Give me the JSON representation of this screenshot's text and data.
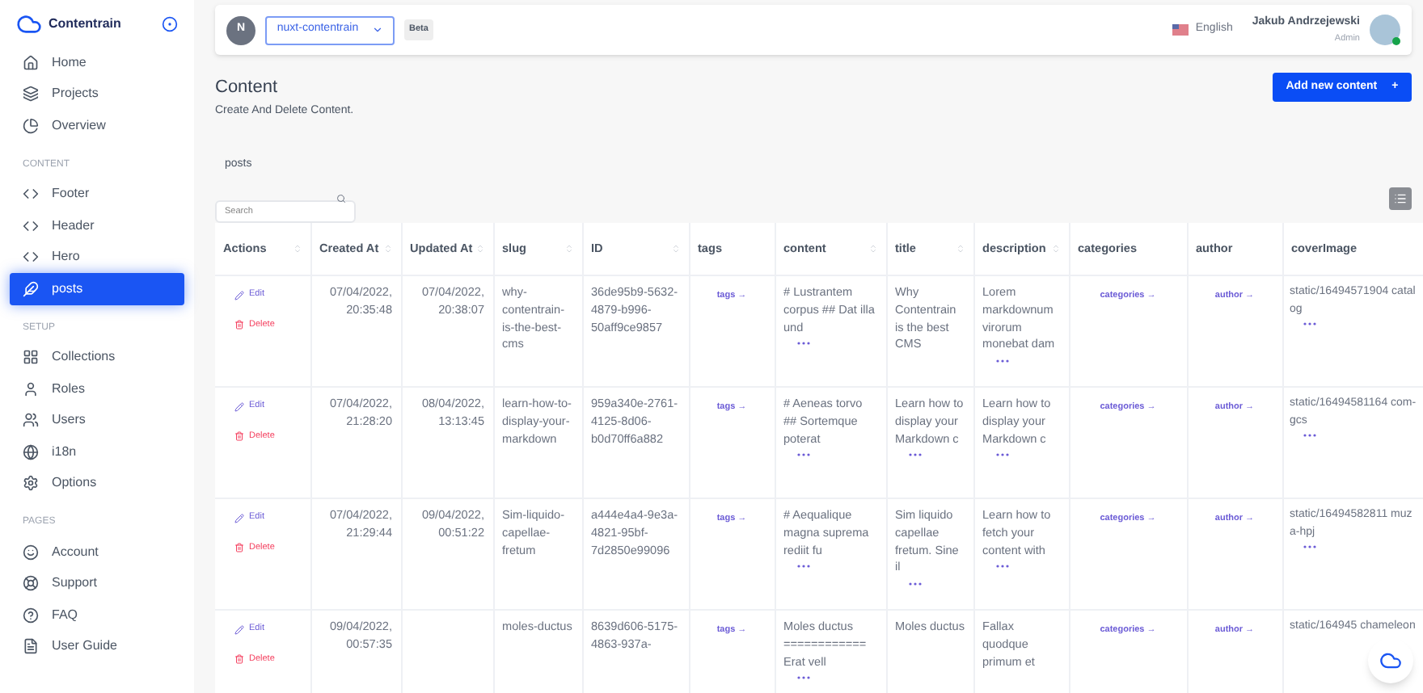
{
  "brand": "Contentrain",
  "sidebar": {
    "sections": [
      {
        "items": [
          {
            "label": "Home",
            "selected": false
          },
          {
            "label": "Projects",
            "selected": false
          },
          {
            "label": "Overview",
            "selected": false
          }
        ]
      },
      {
        "heading": "CONTENT",
        "items": [
          {
            "label": "Footer",
            "selected": false
          },
          {
            "label": "Header",
            "selected": false
          },
          {
            "label": "Hero",
            "selected": false
          },
          {
            "label": "posts",
            "selected": true
          }
        ]
      },
      {
        "heading": "SETUP",
        "items": [
          {
            "label": "Collections",
            "selected": false
          },
          {
            "label": "Roles",
            "selected": false
          },
          {
            "label": "Users",
            "selected": false
          },
          {
            "label": "i18n",
            "selected": false
          },
          {
            "label": "Options",
            "selected": false
          }
        ]
      },
      {
        "heading": "PAGES",
        "items": [
          {
            "label": "Account",
            "selected": false
          },
          {
            "label": "Support",
            "selected": false
          },
          {
            "label": "FAQ",
            "selected": false
          },
          {
            "label": "User Guide",
            "selected": false
          }
        ]
      }
    ]
  },
  "topbar": {
    "project_initial": "N",
    "project": "nuxt-contentrain",
    "badge": "Beta",
    "language": "English",
    "user_name": "Jakub Andrzejewski",
    "user_role": "Admin",
    "online": true
  },
  "page": {
    "title": "Content",
    "subtitle": "Create And Delete Content.",
    "add_button": "Add new content",
    "plus": "+"
  },
  "collection": "posts",
  "search": {
    "placeholder": "Search"
  },
  "table": {
    "columns": [
      {
        "label": "Actions",
        "sortable": true
      },
      {
        "label": "Created At",
        "sortable": true
      },
      {
        "label": "Updated At",
        "sortable": true
      },
      {
        "label": "slug",
        "sortable": true
      },
      {
        "label": "ID",
        "sortable": true
      },
      {
        "label": "tags",
        "sortable": false
      },
      {
        "label": "content",
        "sortable": true
      },
      {
        "label": "title",
        "sortable": true
      },
      {
        "label": "description",
        "sortable": true
      },
      {
        "label": "categories",
        "sortable": false
      },
      {
        "label": "author",
        "sortable": false
      },
      {
        "label": "coverImage",
        "sortable": false
      }
    ],
    "rows": [
      {
        "edit": "Edit",
        "delete": "Delete",
        "created": "07/04/2022, 20:35:48",
        "updated": "07/04/2022, 20:38:07",
        "slug": "why-contentrain-is-the-best-cms",
        "id": "36de95b9-5632-4879-b996-50aff9ce9857",
        "tags": "tags →",
        "content": {
          "text": "# Lustrantem corpus ## Dat illa und",
          "truncated": true
        },
        "title": {
          "text": "Why Contentrain is the best CMS",
          "truncated": false
        },
        "description": {
          "text": "Lorem markdownum virorum monebat dam",
          "truncated": true
        },
        "categories": "categories →",
        "author": "author →",
        "cover": {
          "text": "static/16494571904 catalog",
          "truncated": true
        }
      },
      {
        "edit": "Edit",
        "delete": "Delete",
        "created": "07/04/2022, 21:28:20",
        "updated": "08/04/2022, 13:13:45",
        "slug": "learn-how-to-display-your-markdown",
        "id": "959a340e-2761-4125-8d06-b0d70ff6a882",
        "tags": "tags →",
        "content": {
          "text": "# Aeneas torvo ## Sortemque poterat",
          "truncated": true
        },
        "title": {
          "text": "Learn how to display your Markdown c",
          "truncated": true
        },
        "description": {
          "text": "Learn how to display your Markdown c",
          "truncated": true
        },
        "categories": "categories →",
        "author": "author →",
        "cover": {
          "text": "static/16494581164 com-gcs",
          "truncated": true
        }
      },
      {
        "edit": "Edit",
        "delete": "Delete",
        "created": "07/04/2022, 21:29:44",
        "updated": "09/04/2022, 00:51:22",
        "slug": "Sim-liquido-capellae-fretum",
        "id": "a444e4a4-9e3a-4821-95bf-7d2850e99096",
        "tags": "tags →",
        "content": {
          "text": "# Aequalique magna suprema rediit fu",
          "truncated": true
        },
        "title": {
          "text": "Sim liquido capellae fretum. Sine il",
          "truncated": true
        },
        "description": {
          "text": "Learn how to fetch your content with",
          "truncated": true
        },
        "categories": "categories →",
        "author": "author →",
        "cover": {
          "text": "static/16494582811 muza-hpj",
          "truncated": true
        }
      },
      {
        "edit": "Edit",
        "delete": "Delete",
        "created": "09/04/2022, 00:57:35",
        "slug": "moles-ductus",
        "id": "8639d606-5175-4863-937a-",
        "tags": "tags →",
        "content": {
          "text": "Moles ductus ============ Erat vell",
          "truncated": true
        },
        "title": {
          "text": "Moles ductus",
          "truncated": false
        },
        "description": {
          "text": "Fallax quodque primum et",
          "truncated": false
        },
        "categories": "categories →",
        "author": "author →",
        "cover": {
          "text": "static/164945 chameleon",
          "truncated": false
        }
      }
    ]
  }
}
